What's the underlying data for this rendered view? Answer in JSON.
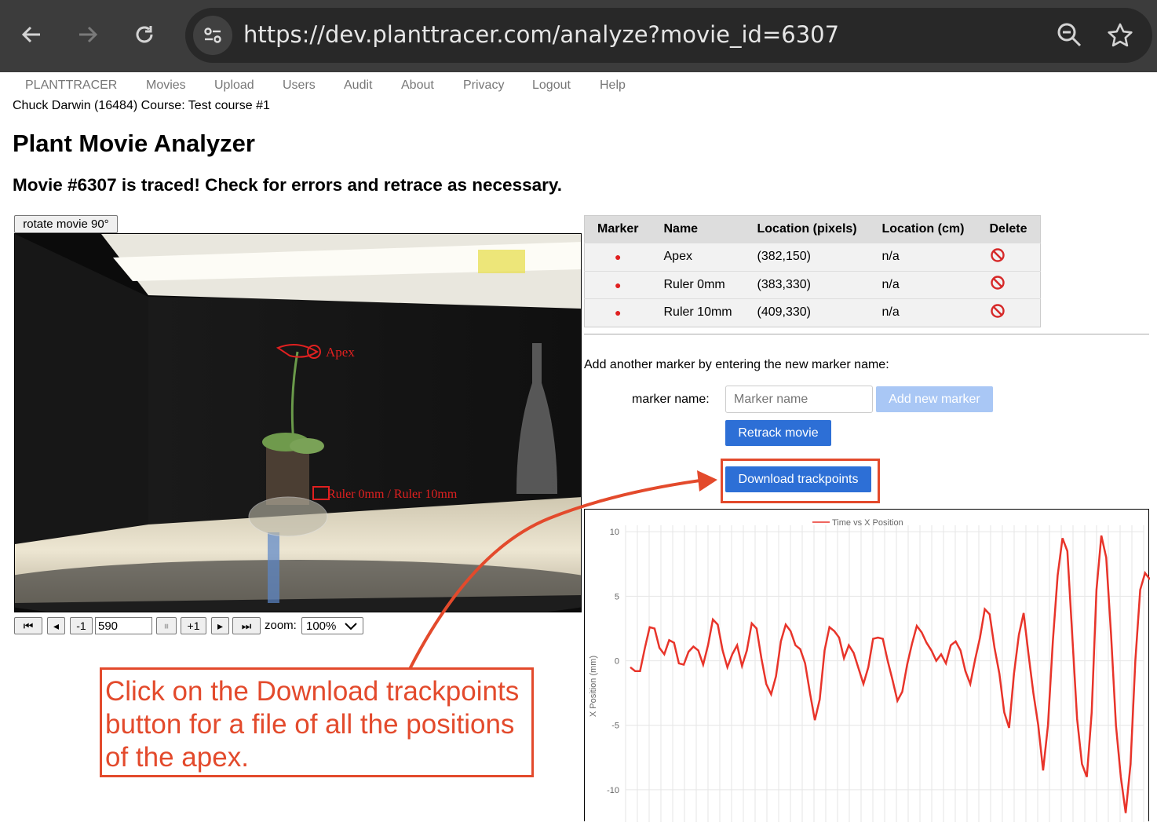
{
  "browser": {
    "url": "https://dev.planttracer.com/analyze?movie_id=6307"
  },
  "nav": {
    "items": [
      "PLANTTRACER",
      "Movies",
      "Upload",
      "Users",
      "Audit",
      "About",
      "Privacy",
      "Logout",
      "Help"
    ]
  },
  "user_line": "Chuck Darwin (16484) Course: Test course #1",
  "page_title": "Plant Movie Analyzer",
  "status_message": "Movie #6307 is traced! Check for errors and retrace as necessary.",
  "movie": {
    "rotate_label": "rotate movie 90°",
    "overlay_labels": {
      "apex": "Apex",
      "rulers": "Ruler 0mm / Ruler 10mm"
    },
    "controls": {
      "first": "⏮",
      "prev": "◂",
      "minus_one": "-1",
      "frame_value": "590",
      "pause": "⏸",
      "plus_one": "+1",
      "play": "▸",
      "last": "⏭",
      "zoom_label": "zoom:",
      "zoom_value": "100%"
    }
  },
  "markers_table": {
    "headers": [
      "Marker",
      "Name",
      "Location (pixels)",
      "Location (cm)",
      "Delete"
    ],
    "rows": [
      {
        "marker": "●",
        "name": "Apex",
        "pixels": "(382,150)",
        "cm": "n/a"
      },
      {
        "marker": "●",
        "name": "Ruler 0mm",
        "pixels": "(383,330)",
        "cm": "n/a"
      },
      {
        "marker": "●",
        "name": "Ruler 10mm",
        "pixels": "(409,330)",
        "cm": "n/a"
      }
    ]
  },
  "add_marker": {
    "instructions": "Add another marker by entering the new marker name:",
    "label": "marker name:",
    "placeholder": "Marker name",
    "add_button": "Add new marker",
    "retrack_button": "Retrack movie",
    "download_button": "Download trackpoints"
  },
  "annotation": {
    "text": "Click on the Download trackpoints button for a file of all the positions of the apex."
  },
  "colors": {
    "accent_red": "#e34a2c",
    "button_blue": "#2d6fd6",
    "line_red": "#e8342a"
  },
  "chart_data": {
    "type": "line",
    "title": "Time vs X Position",
    "ylabel": "X Position (mm)",
    "xlabel": "",
    "ylim": [
      -12.5,
      10.5
    ],
    "yticks": [
      10,
      5,
      0,
      -5,
      -10
    ],
    "grid": true,
    "legend": "top",
    "series": [
      {
        "name": "Time vs X Position",
        "values": [
          -0.5,
          -0.8,
          -0.8,
          1.0,
          2.6,
          2.5,
          1.0,
          0.5,
          1.6,
          1.4,
          -0.2,
          -0.3,
          0.7,
          1.1,
          0.8,
          -0.3,
          1.2,
          3.2,
          2.8,
          0.8,
          -0.5,
          0.5,
          1.2,
          -0.4,
          0.8,
          2.9,
          2.5,
          0.2,
          -1.8,
          -2.6,
          -1.2,
          1.5,
          2.8,
          2.3,
          1.2,
          0.9,
          -0.2,
          -2.5,
          -4.6,
          -3.0,
          0.8,
          2.6,
          2.3,
          1.8,
          0.2,
          1.2,
          0.6,
          -0.6,
          -1.8,
          -0.5,
          1.7,
          1.8,
          1.7,
          0.0,
          -1.5,
          -3.1,
          -2.4,
          -0.3,
          1.3,
          2.7,
          2.2,
          1.4,
          0.8,
          0.0,
          0.5,
          -0.2,
          1.2,
          1.5,
          0.8,
          -0.8,
          -1.8,
          0.1,
          1.8,
          4.0,
          3.6,
          1.0,
          -1.0,
          -4.0,
          -5.2,
          -1.0,
          2.0,
          3.7,
          0.5,
          -2.5,
          -5.0,
          -8.5,
          -5.0,
          1.5,
          6.6,
          9.5,
          8.5,
          2.0,
          -4.5,
          -8.0,
          -9.0,
          -4.0,
          5.5,
          9.7,
          8.0,
          2.0,
          -5.0,
          -9.0,
          -11.8,
          -8.0,
          0.0,
          5.5,
          6.8,
          6.3
        ]
      }
    ]
  }
}
